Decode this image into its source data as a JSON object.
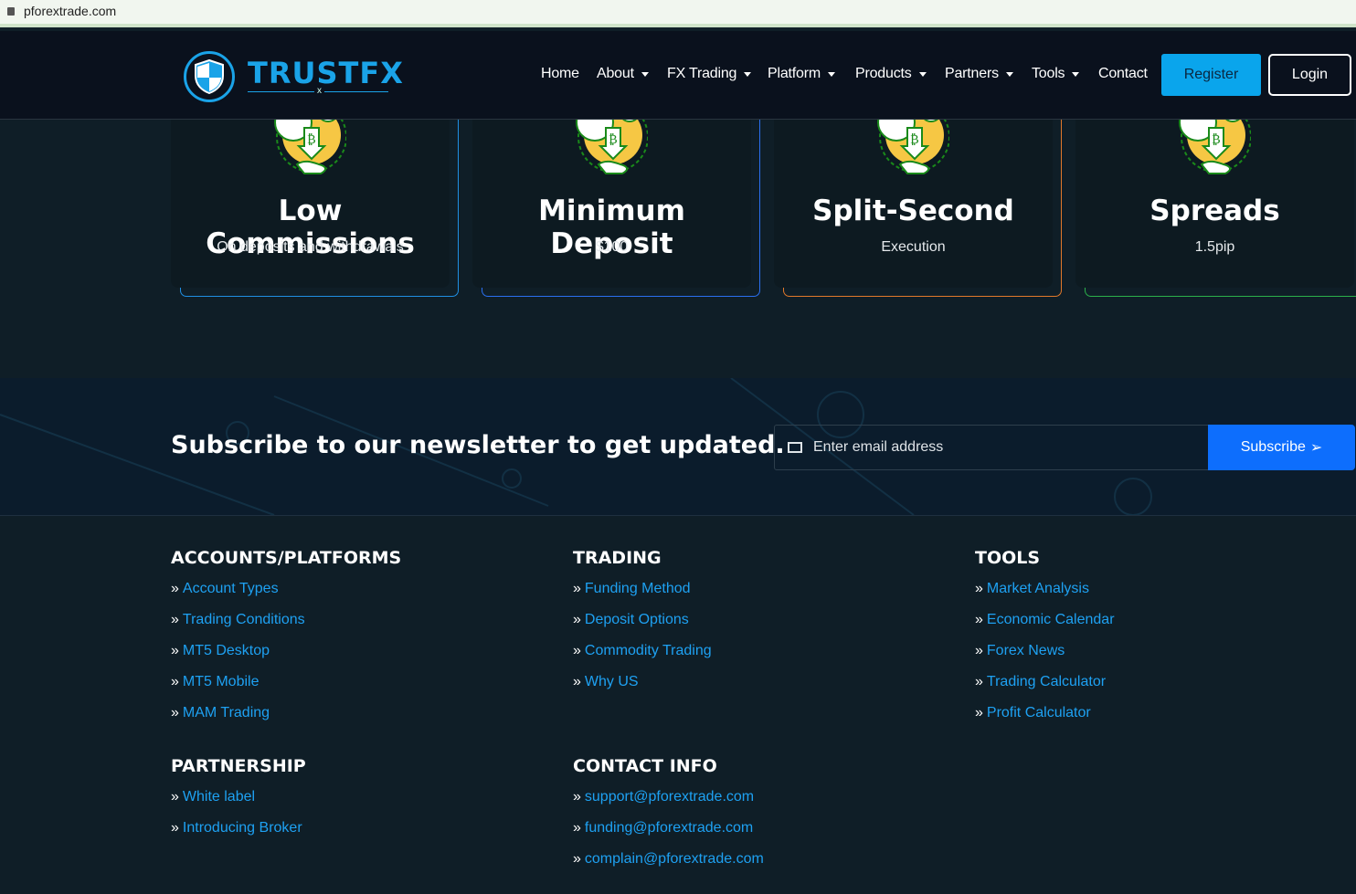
{
  "browser": {
    "url": "pforextrade.com"
  },
  "header": {
    "logo": "TRUSTFX",
    "logo_mark": "x",
    "nav": [
      {
        "label": "Home",
        "dropdown": false
      },
      {
        "label": "About",
        "dropdown": true
      },
      {
        "label": "FX Trading",
        "dropdown": true
      },
      {
        "label": "Platform",
        "dropdown": true
      },
      {
        "label": "Products",
        "dropdown": true
      },
      {
        "label": "Partners",
        "dropdown": true
      },
      {
        "label": "Tools",
        "dropdown": true
      },
      {
        "label": "Contact",
        "dropdown": false
      }
    ],
    "register": "Register",
    "login": "Login"
  },
  "features": [
    {
      "title": "Low Commissions",
      "subtitle": "On deposits and withdrawals",
      "color": "#1f8fe3"
    },
    {
      "title": "Minimum Deposit",
      "subtitle": "$100",
      "color": "#2a6ff0"
    },
    {
      "title": "Split-Second",
      "subtitle": "Execution",
      "color": "#e0782a"
    },
    {
      "title": "Spreads",
      "subtitle": "1.5pip",
      "color": "#2bb04a"
    }
  ],
  "newsletter": {
    "heading": "Subscribe to our newsletter to get updated.",
    "placeholder": "Enter email address",
    "button": "Subscribe"
  },
  "footer": {
    "accounts": {
      "title": "ACCOUNTS/PLATFORMS",
      "links": [
        "Account Types",
        "Trading Conditions",
        "MT5 Desktop",
        "MT5 Mobile",
        "MAM Trading"
      ]
    },
    "trading": {
      "title": "TRADING",
      "links": [
        "Funding Method",
        "Deposit Options",
        "Commodity Trading",
        "Why US"
      ]
    },
    "tools": {
      "title": "TOOLS",
      "links": [
        "Market Analysis",
        "Economic Calendar",
        "Forex News",
        "Trading Calculator",
        "Profit Calculator"
      ]
    },
    "partnership": {
      "title": "PARTNERSHIP",
      "links": [
        "White label",
        "Introducing Broker"
      ]
    },
    "contact": {
      "title": "CONTACT INFO",
      "links": [
        "support@pforextrade.com",
        "funding@pforextrade.com",
        "complain@pforextrade.com"
      ]
    }
  }
}
